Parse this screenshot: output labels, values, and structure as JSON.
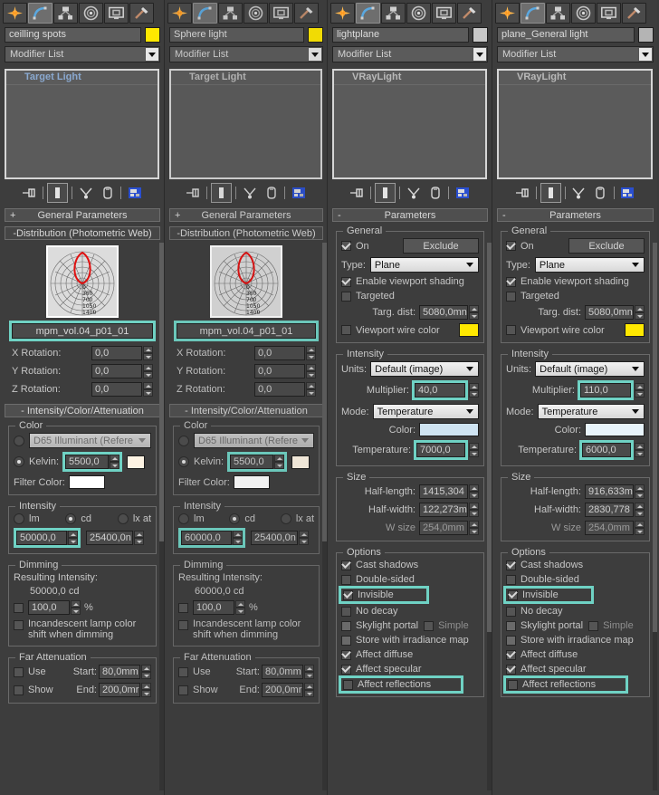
{
  "tabs": [
    {
      "name": "create-tab",
      "icon": "star-icon",
      "active": false
    },
    {
      "name": "modify-tab",
      "icon": "arc-icon",
      "active": true
    },
    {
      "name": "hierarchy-tab",
      "icon": "hierarchy-icon",
      "active": false
    },
    {
      "name": "motion-tab",
      "icon": "motion-icon",
      "active": false
    },
    {
      "name": "display-tab",
      "icon": "display-icon",
      "active": false
    },
    {
      "name": "utilities-tab",
      "icon": "hammer-icon",
      "active": false
    }
  ],
  "stack_tools": [
    "pin-stack-icon",
    "show-end-result-icon",
    "make-unique-icon",
    "remove-modifier-icon",
    "configure-sets-icon"
  ],
  "common": {
    "modifier_list": "Modifier List",
    "general_parameters": "General Parameters",
    "distribution_title": "-Distribution (Photometric Web)",
    "intensity_color_att": "- Intensity/Color/Attenuation",
    "color_group": "Color",
    "intensity_group": "Intensity",
    "dimming_group": "Dimming",
    "far_atten_group": "Far Attenuation",
    "d65_label": "D65 Illuminant (Refere",
    "kelvin_label": "Kelvin:",
    "filter_color_label": "Filter Color:",
    "lm_label": "lm",
    "cd_label": "cd",
    "lx_label": "lx at",
    "resulting_intensity_label": "Resulting Intensity:",
    "dim_percent": "100,0",
    "percent_sign": "%",
    "incandescent_label": "Incandescent lamp color shift when dimming",
    "use_label": "Use",
    "show_label": "Show",
    "start_label": "Start:",
    "end_label": "End:",
    "atten_start": "80,0mm",
    "atten_end": "200,0mr",
    "x_rotation_label": "X Rotation:",
    "y_rotation_label": "Y Rotation:",
    "z_rotation_label": "Z Rotation:",
    "rot_value": "0,0",
    "web_labels": [
      "0",
      "350",
      "700",
      "1050",
      "1400"
    ],
    "parameters_title": "Parameters",
    "general_group": "General",
    "on_label": "On",
    "exclude_label": "Exclude",
    "type_label": "Type:",
    "type_value": "Plane",
    "enable_vp_shading": "Enable viewport shading",
    "targeted_label": "Targeted",
    "targ_dist_label": "Targ. dist:",
    "targ_dist_value": "5080,0mn",
    "vp_wire_color": "Viewport wire color",
    "units_label": "Units:",
    "units_value": "Default (image)",
    "multiplier_label": "Multiplier:",
    "mode_label": "Mode:",
    "mode_value": "Temperature",
    "color_label": "Color:",
    "temperature_label": "Temperature:",
    "size_group": "Size",
    "half_length_label": "Half-length:",
    "half_width_label": "Half-width:",
    "w_size_label": "W size",
    "w_size_value": "254,0mm",
    "options_group": "Options",
    "opt_cast_shadows": "Cast shadows",
    "opt_double_sided": "Double-sided",
    "opt_invisible": "Invisible",
    "opt_no_decay": "No decay",
    "opt_skylight_portal": "Skylight portal",
    "opt_simple": "Simple",
    "opt_store_irradiance": "Store with irradiance map",
    "opt_affect_diffuse": "Affect diffuse",
    "opt_affect_specular": "Affect specular",
    "opt_affect_reflections": "Affect reflections"
  },
  "panels": [
    {
      "id": "panel-1",
      "object_name": "ceilling spots",
      "wire_color": "#ffe800",
      "stack_item": "Target Light",
      "stack_selected": true,
      "web_file": "mpm_vol.04_p01_01",
      "kelvin": "5500,0",
      "intensity_cd": "50000,0",
      "intensity_lx": "25400,0n",
      "resulting_intensity": "50000,0 cd",
      "kelvin_swatch": "#fdf3e3",
      "highlights": [
        "web_file",
        "kelvin",
        "intensity_cd"
      ]
    },
    {
      "id": "panel-2",
      "object_name": "Sphere light",
      "wire_color": "#ffe800",
      "stack_item": "Target Light",
      "stack_selected": false,
      "web_file": "mpm_vol.04_p01_01",
      "kelvin": "5500,0",
      "intensity_cd": "60000,0",
      "intensity_lx": "25400,0n",
      "resulting_intensity": "60000,0 cd",
      "kelvin_swatch": "#fdf3e3",
      "highlights": [
        "web_file",
        "kelvin",
        "intensity_cd"
      ]
    },
    {
      "id": "panel-3",
      "object_name": "lightplane",
      "wire_color": "#c8c8c8",
      "stack_item": "VRayLight",
      "stack_selected": false,
      "vray_wire_color": "#ffe800",
      "multiplier": "40,0",
      "temperature": "7000,0",
      "light_color": "#cfe4f2",
      "half_length": "1415,304",
      "half_width": "122,273m",
      "checks": {
        "on": true,
        "enable_vp_shading": true,
        "targeted": false,
        "vp_wire_color": false,
        "cast_shadows": true,
        "double_sided": false,
        "invisible": true,
        "no_decay": false,
        "skylight_portal": false,
        "simple": false,
        "store_irradiance": false,
        "affect_diffuse": true,
        "affect_specular": true,
        "affect_reflections": false
      },
      "highlights": [
        "multiplier",
        "temperature",
        "invisible",
        "affect_reflections"
      ]
    },
    {
      "id": "panel-4",
      "object_name": "plane_General light",
      "wire_color": "#b4b4b4",
      "stack_item": "VRayLight",
      "stack_selected": false,
      "vray_wire_color": "#ffe800",
      "multiplier": "110,0",
      "temperature": "6000,0",
      "light_color": "#e8f4fb",
      "half_length": "916,633m",
      "half_width": "2830,778",
      "checks": {
        "on": true,
        "enable_vp_shading": true,
        "targeted": false,
        "vp_wire_color": false,
        "cast_shadows": true,
        "double_sided": false,
        "invisible": true,
        "no_decay": false,
        "skylight_portal": false,
        "simple": false,
        "store_irradiance": false,
        "affect_diffuse": true,
        "affect_specular": true,
        "affect_reflections": false
      },
      "highlights": [
        "multiplier",
        "temperature",
        "invisible",
        "affect_reflections"
      ]
    }
  ]
}
